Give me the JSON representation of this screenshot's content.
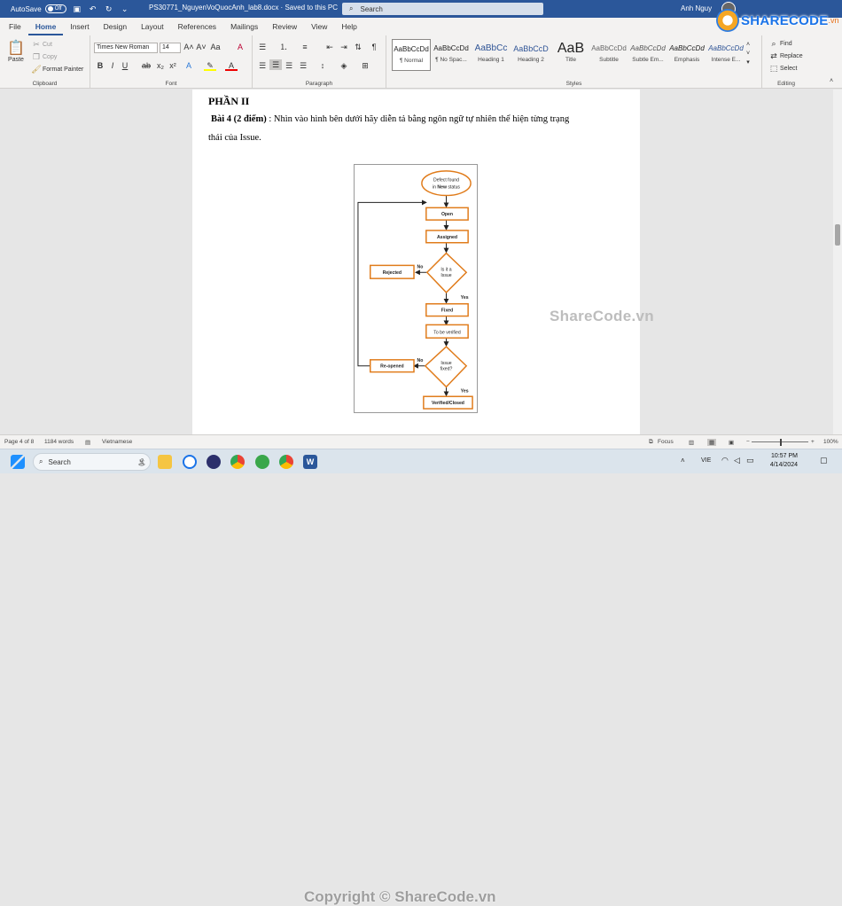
{
  "titlebar": {
    "autosave_label": "AutoSave",
    "autosave_state": "Off",
    "doc_title": "PS30771_NguyenVoQuocAnh_lab8.docx  ·  Saved to this PC",
    "search_placeholder": "Search",
    "user_name": "Anh Nguy"
  },
  "logo": {
    "text": "SHARECODE",
    "suffix": ".vn"
  },
  "tabs": [
    "File",
    "Home",
    "Insert",
    "Design",
    "Layout",
    "References",
    "Mailings",
    "Review",
    "View",
    "Help"
  ],
  "ribbon": {
    "clipboard": {
      "paste": "Paste",
      "cut": "Cut",
      "copy": "Copy",
      "format_painter": "Format Painter",
      "label": "Clipboard"
    },
    "font": {
      "family": "Times New Roman",
      "size": "14",
      "label": "Font"
    },
    "paragraph": {
      "label": "Paragraph"
    },
    "styles": {
      "label": "Styles",
      "items": [
        {
          "preview": "AaBbCcDd",
          "name": "¶ Normal"
        },
        {
          "preview": "AaBbCcDd",
          "name": "¶ No Spac..."
        },
        {
          "preview": "AaBbCc",
          "name": "Heading 1"
        },
        {
          "preview": "AaBbCcD",
          "name": "Heading 2"
        },
        {
          "preview": "AaB",
          "name": "Title"
        },
        {
          "preview": "AaBbCcDd",
          "name": "Subtitle"
        },
        {
          "preview": "AaBbCcDd",
          "name": "Subtle Em..."
        },
        {
          "preview": "AaBbCcDd",
          "name": "Emphasis"
        },
        {
          "preview": "AaBbCcDd",
          "name": "Intense E..."
        }
      ]
    },
    "editing": {
      "find": "Find",
      "replace": "Replace",
      "select": "Select",
      "label": "Editing"
    }
  },
  "document": {
    "heading": "PHẦN II",
    "q_label": "Bài 4 (2 điểm)",
    "q_text": ": Nhìn vào hình bên dưới hãy diễn tả bằng ngôn ngữ tự nhiên thể hiện từng trạng",
    "q_text2": "thái của Issue.",
    "watermark": "ShareCode.vn"
  },
  "flowchart": {
    "start": "Defect found in New status",
    "open": "Open",
    "assigned": "Assigned",
    "decision1": "Is it a Issue",
    "rejected": "Rejected",
    "no1": "No",
    "yes1": "Yes",
    "fixed": "Fixed",
    "to_be_verified": "To be verified",
    "decision2": "Issue fixed?",
    "reopened": "Re-opened",
    "no2": "No",
    "yes2": "Yes",
    "closed": "Verified/Closed"
  },
  "statusbar": {
    "page": "Page 4 of 8",
    "words": "1184 words",
    "language": "Vietnamese",
    "focus": "Focus",
    "zoom": "100%"
  },
  "taskbar": {
    "search": "Search",
    "lang": "VIE",
    "time": "10:57 PM",
    "date": "4/14/2024",
    "copyright": "Copyright © ShareCode.vn"
  },
  "colors": {
    "word_blue": "#2b579a",
    "box_orange": "#e07b1a"
  }
}
